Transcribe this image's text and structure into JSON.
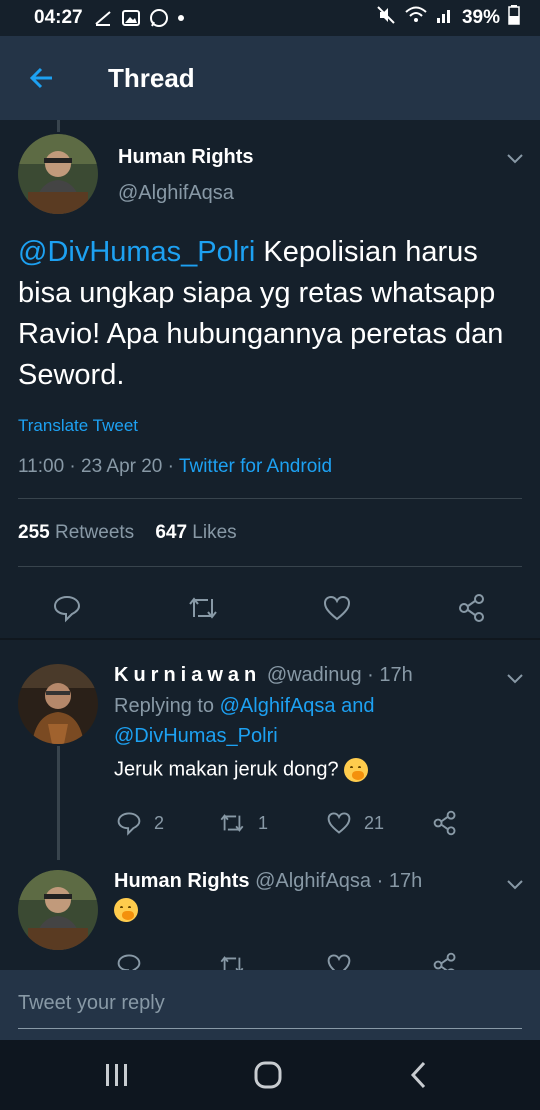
{
  "status_bar": {
    "time": "04:27",
    "battery": "39%",
    "left_icons": [
      "download-icon",
      "image-icon",
      "whatsapp-icon",
      "dot-icon"
    ],
    "right_icons": [
      "mute-icon",
      "wifi-icon",
      "signal-icon",
      "battery-icon"
    ]
  },
  "header": {
    "title": "Thread"
  },
  "main_tweet": {
    "name": "Human Rights",
    "handle": "@AlghifAqsa",
    "mention": "@DivHumas_Polri",
    "text": " Kepolisian harus bisa ungkap siapa yg retas whatsapp Ravio! Apa hubungannya peretas dan Seword.",
    "translate": "Translate Tweet",
    "time": "11:00",
    "date": "23 Apr 20",
    "source": "Twitter for Android",
    "retweets_count": "255",
    "retweets_label": "Retweets",
    "likes_count": "647",
    "likes_label": "Likes"
  },
  "replies": [
    {
      "name": "Kurniawan",
      "handle": "@wadinug",
      "age": "17h",
      "replying_prefix": "Replying to ",
      "replying_handle1": "@AlghifAqsa",
      "replying_and": " and",
      "replying_handle2": "@DivHumas_Polri",
      "text": "Jeruk makan jeruk dong?",
      "reply_count": "2",
      "retweet_count": "1",
      "like_count": "21"
    },
    {
      "name": "Human Rights",
      "handle": "@AlghifAqsa",
      "age": "17h"
    }
  ],
  "composer": {
    "placeholder": "Tweet your reply"
  },
  "colors": {
    "background": "#15202b",
    "header": "#243447",
    "accent": "#1da1f2",
    "secondary_text": "#8899a6",
    "divider": "#38444d"
  }
}
